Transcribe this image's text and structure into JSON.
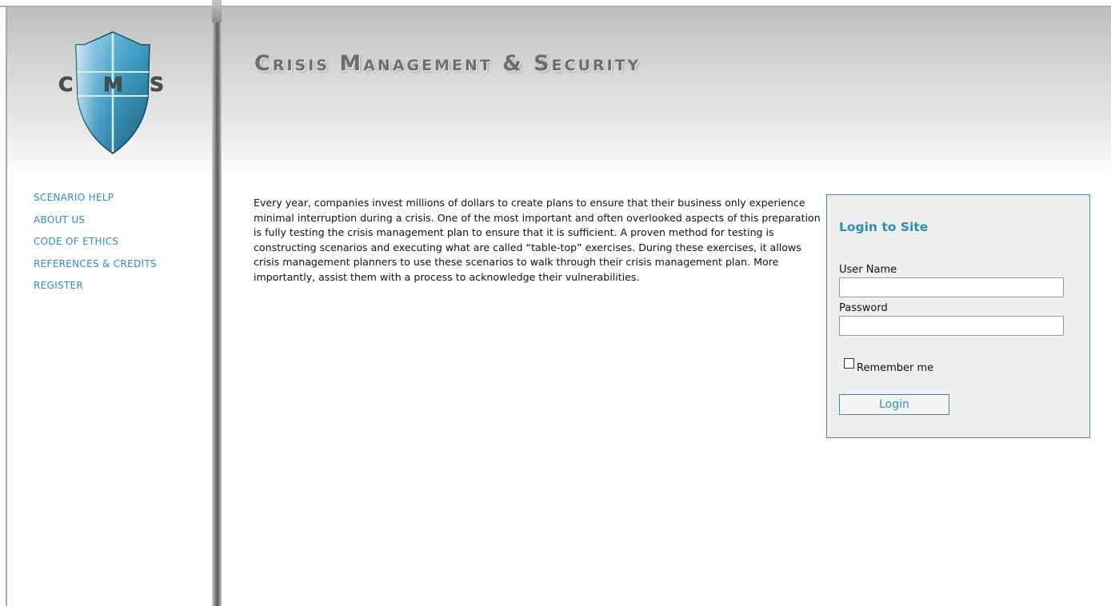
{
  "header": {
    "title": "Crisis Management & Security",
    "logo_text": "CMS",
    "logo_letters": [
      "C",
      "M",
      "S"
    ]
  },
  "nav": {
    "items": [
      {
        "label": "SCENARIO HELP"
      },
      {
        "label": "ABOUT US"
      },
      {
        "label": "CODE OF ETHICS"
      },
      {
        "label": "REFERENCES & CREDITS"
      },
      {
        "label": "REGISTER"
      }
    ]
  },
  "main": {
    "intro": "Every year, companies invest millions of dollars to create plans to ensure that their business only experience minimal interruption during a crisis. One of the most important and often overlooked aspects of this preparation is fully testing the crisis management plan to ensure that it is sufficient. A proven method for testing is constructing scenarios and executing what are called “table-top” exercises. During these exercises, it allows crisis management planners to use these scenarios to walk through their crisis management plan. More importantly, assist them with a process to acknowledge their vulnerabilities."
  },
  "login": {
    "title": "Login to Site",
    "username_label": "User Name",
    "username_value": "",
    "password_label": "Password",
    "password_value": "",
    "remember_label": "Remember me",
    "remember_checked": false,
    "button_label": "Login"
  },
  "colors": {
    "accent": "#2a8fb5",
    "border": "#3a8ca7",
    "title_text": "#6e6e6e",
    "login_panel_bg": "#eeeeee"
  },
  "icons": {
    "logo": "shield-logo-icon"
  }
}
